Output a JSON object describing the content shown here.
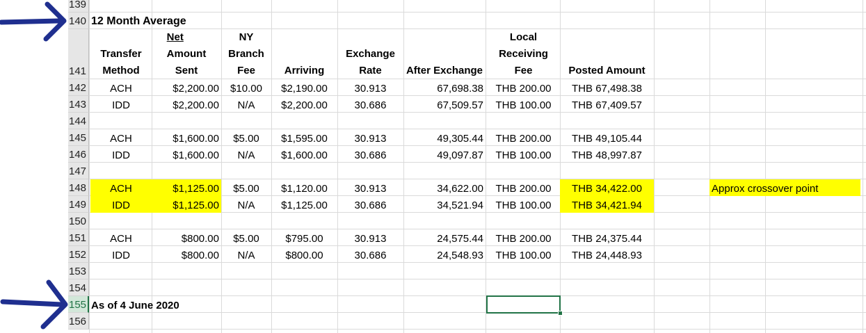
{
  "sheet": {
    "rows": [
      "139",
      "140",
      "141",
      "142",
      "143",
      "144",
      "145",
      "146",
      "147",
      "148",
      "149",
      "150",
      "151",
      "152",
      "153",
      "154",
      "155",
      "156"
    ],
    "active_row": "155",
    "title": "12 Month Average",
    "as_of": "As of 4 June 2020",
    "note": "Approx crossover point"
  },
  "headers": {
    "method": [
      "Transfer",
      "Method"
    ],
    "net_amount": [
      "Net Amount",
      "Sent"
    ],
    "ny_fee": [
      "NY",
      "Branch",
      "Fee"
    ],
    "arriving": [
      "Arriving"
    ],
    "rate": [
      "Exchange",
      "Rate"
    ],
    "after_exchange": [
      "After Exchange"
    ],
    "local_fee": [
      "Local",
      "Receiving",
      "Fee"
    ],
    "posted": [
      "Posted Amount"
    ]
  },
  "data_rows": [
    {
      "row": "142",
      "method": "ACH",
      "sent": "$2,200.00",
      "fee": "$10.00",
      "arriving": "$2,190.00",
      "rate": "30.913",
      "after": "67,698.38",
      "local_fee": "THB 200.00",
      "posted": "THB 67,498.38"
    },
    {
      "row": "143",
      "method": "IDD",
      "sent": "$2,200.00",
      "fee": "N/A",
      "arriving": "$2,200.00",
      "rate": "30.686",
      "after": "67,509.57",
      "local_fee": "THB 100.00",
      "posted": "THB 67,409.57"
    },
    {
      "row": "145",
      "method": "ACH",
      "sent": "$1,600.00",
      "fee": "$5.00",
      "arriving": "$1,595.00",
      "rate": "30.913",
      "after": "49,305.44",
      "local_fee": "THB 200.00",
      "posted": "THB 49,105.44"
    },
    {
      "row": "146",
      "method": "IDD",
      "sent": "$1,600.00",
      "fee": "N/A",
      "arriving": "$1,600.00",
      "rate": "30.686",
      "after": "49,097.87",
      "local_fee": "THB 100.00",
      "posted": "THB 48,997.87"
    },
    {
      "row": "148",
      "method": "ACH",
      "sent": "$1,125.00",
      "fee": "$5.00",
      "arriving": "$1,120.00",
      "rate": "30.913",
      "after": "34,622.00",
      "local_fee": "THB 200.00",
      "posted": "THB 34,422.00"
    },
    {
      "row": "149",
      "method": "IDD",
      "sent": "$1,125.00",
      "fee": "N/A",
      "arriving": "$1,125.00",
      "rate": "30.686",
      "after": "34,521.94",
      "local_fee": "THB 100.00",
      "posted": "THB 34,421.94"
    },
    {
      "row": "151",
      "method": "ACH",
      "sent": "$800.00",
      "fee": "$5.00",
      "arriving": "$795.00",
      "rate": "30.913",
      "after": "24,575.44",
      "local_fee": "THB 200.00",
      "posted": "THB 24,375.44"
    },
    {
      "row": "152",
      "method": "IDD",
      "sent": "$800.00",
      "fee": "N/A",
      "arriving": "$800.00",
      "rate": "30.686",
      "after": "24,548.93",
      "local_fee": "THB 100.00",
      "posted": "THB 24,448.93"
    }
  ],
  "colors": {
    "highlight": "#ffff00",
    "selection": "#217346",
    "annotation_arrow": "#1f2f8f"
  },
  "annotations": {
    "icon": "arrow-right-icon",
    "count": 2
  }
}
